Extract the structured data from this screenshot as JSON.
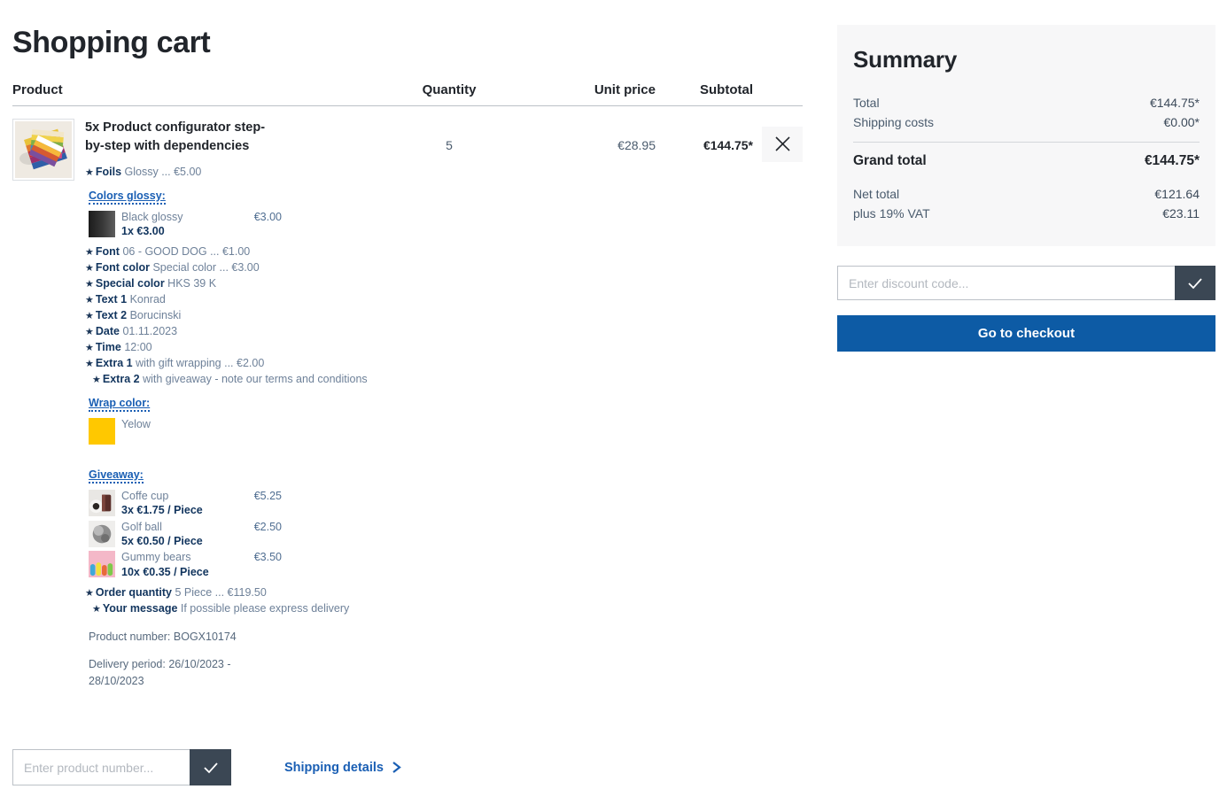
{
  "page": {
    "title": "Shopping cart"
  },
  "table": {
    "headers": {
      "product": "Product",
      "quantity": "Quantity",
      "unit_price": "Unit price",
      "subtotal": "Subtotal"
    }
  },
  "item": {
    "name": "5x Product configurator step-by-step with dependencies",
    "thumbnail_icon": "color-fan-swatch-image",
    "quantity": "5",
    "unit_price": "€28.95",
    "subtotal": "€144.75*",
    "remove_icon": "close-icon",
    "options": [
      {
        "label": "Foils",
        "value": "Glossy ... €5.00"
      },
      {
        "label": "Font",
        "value": "06 - GOOD DOG ... €1.00"
      },
      {
        "label": "Font color",
        "value": "Special color ... €3.00"
      },
      {
        "label": "Special color",
        "value": "HKS 39 K"
      },
      {
        "label": "Text 1",
        "value": "Konrad"
      },
      {
        "label": "Text 2",
        "value": "Borucinski"
      },
      {
        "label": "Date",
        "value": "01.11.2023"
      },
      {
        "label": "Time",
        "value": "12:00"
      },
      {
        "label": "Extra 1",
        "value": "with gift wrapping ... €2.00"
      },
      {
        "label": "Extra 2",
        "value": "with giveaway - note our terms and conditions"
      }
    ],
    "colors_glossy": {
      "heading": "Colors glossy:",
      "entries": [
        {
          "name": "Black glossy",
          "price": "€3.00",
          "qty": "1x €3.00",
          "swatch": "black-glossy-gradient-swatch"
        }
      ]
    },
    "wrap_color": {
      "heading": "Wrap color:",
      "entries": [
        {
          "name": "Yelow",
          "price": "",
          "qty": "",
          "swatch": "yellow-color-swatch"
        }
      ]
    },
    "giveaway": {
      "heading": "Giveaway:",
      "entries": [
        {
          "name": "Coffe cup",
          "price": "€5.25",
          "qty": "3x €1.75 / Piece",
          "swatch": "coffee-cup-image"
        },
        {
          "name": "Golf ball",
          "price": "€2.50",
          "qty": "5x €0.50 / Piece",
          "swatch": "golf-ball-image"
        },
        {
          "name": "Gummy bears",
          "price": "€3.50",
          "qty": "10x €0.35 / Piece",
          "swatch": "gummy-bears-image"
        }
      ]
    },
    "options_after": [
      {
        "label": "Order quantity",
        "value": "5 Piece ... €119.50"
      },
      {
        "label": "Your message",
        "value": "If possible please express delivery"
      }
    ],
    "product_number": "Product number: BOGX10174",
    "delivery_period": "Delivery period: 26/10/2023 - 28/10/2023"
  },
  "bottom": {
    "product_number_placeholder": "Enter product number...",
    "product_number_value": "",
    "submit_icon": "check-icon",
    "shipping_details_label": "Shipping details",
    "shipping_chevron_icon": "chevron-right-icon"
  },
  "summary": {
    "title": "Summary",
    "rows": [
      {
        "label": "Total",
        "value": "€144.75*"
      },
      {
        "label": "Shipping costs",
        "value": "€0.00*"
      }
    ],
    "grand": {
      "label": "Grand total",
      "value": "€144.75*"
    },
    "sub_rows": [
      {
        "label": "Net total",
        "value": "€121.64"
      },
      {
        "label": "plus 19% VAT",
        "value": "€23.11"
      }
    ],
    "discount_placeholder": "Enter discount code...",
    "discount_value": "",
    "discount_submit_icon": "check-icon",
    "checkout_label": "Go to checkout"
  },
  "colors": {
    "accent_blue": "#1a5fb4",
    "checkout_blue": "#0d5ba5",
    "label_navy": "#12355e",
    "value_gray": "#6e8199",
    "panel_bg": "#f7f7f8",
    "dark_button": "#3b4754",
    "yellow_swatch": "#ffc800"
  }
}
